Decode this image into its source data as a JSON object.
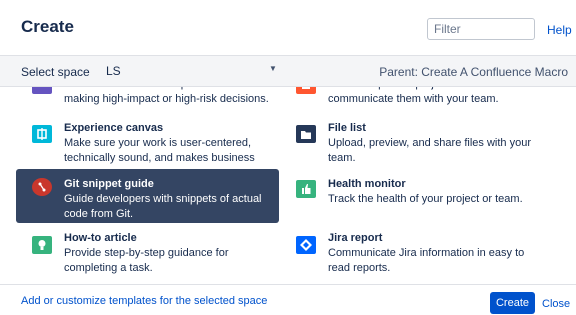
{
  "dialog": {
    "title": "Create",
    "help_label": "Help",
    "filter_placeholder": "Filter"
  },
  "space": {
    "label": "Select space",
    "selected": "LS",
    "parent": "Parent: Create A Confluence Macro"
  },
  "templates": [
    {
      "name": "",
      "description": "Define the roles and responsibilities for making high-impact or high-risk decisions.",
      "icon": "people-icon",
      "color": "#6554c0"
    },
    {
      "name": "",
      "description": "Record important project decisions and communicate them with your team.",
      "icon": "decision-icon",
      "color": "#ff5630"
    },
    {
      "name": "Experience canvas",
      "description": "Make sure your work is user-centered, technically sound, and makes business sense.",
      "icon": "canvas-icon",
      "color": "#00b8d9"
    },
    {
      "name": "File list",
      "description": "Upload, preview, and share files with your team.",
      "icon": "folder-icon",
      "color": "#253858"
    },
    {
      "name": "Git snippet guide",
      "description": "Guide developers with snippets of actual code from Git.",
      "icon": "git-icon",
      "color": "#c9372c",
      "selected": true
    },
    {
      "name": "Health monitor",
      "description": "Track the health of your project or team.",
      "icon": "thumbs-up-icon",
      "color": "#36b37e"
    },
    {
      "name": "How-to article",
      "description": "Provide step-by-step guidance for completing a task.",
      "icon": "lightbulb-icon",
      "color": "#36b37e"
    },
    {
      "name": "Jira report",
      "description": "Communicate Jira information in easy to read reports.",
      "icon": "jira-icon",
      "color": "#0065ff"
    }
  ],
  "footer": {
    "add_link": "Add or customize templates for the selected space",
    "create_label": "Create",
    "close_label": "Close"
  }
}
